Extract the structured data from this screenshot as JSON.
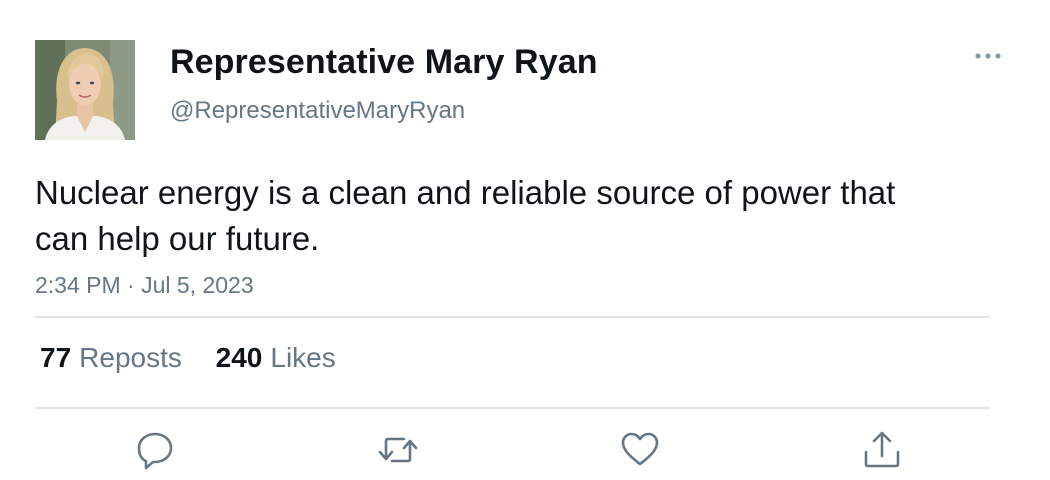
{
  "author": {
    "display_name": "Representative Mary Ryan",
    "handle": "@RepresentativeMaryRyan"
  },
  "tweet": {
    "text": "Nuclear energy is a clean and reliable source of power that can help our future.",
    "timestamp": "2:34 PM · Jul 5, 2023"
  },
  "stats": {
    "reposts_count": "77",
    "reposts_label": "Reposts",
    "likes_count": "240",
    "likes_label": "Likes"
  },
  "icons": {
    "more": "more-horizontal-icon",
    "reply": "reply-icon",
    "repost": "repost-icon",
    "like": "heart-icon",
    "share": "share-icon"
  },
  "colors": {
    "text": "#0f1419",
    "secondary": "#657786",
    "divider": "#e1e5e8"
  }
}
